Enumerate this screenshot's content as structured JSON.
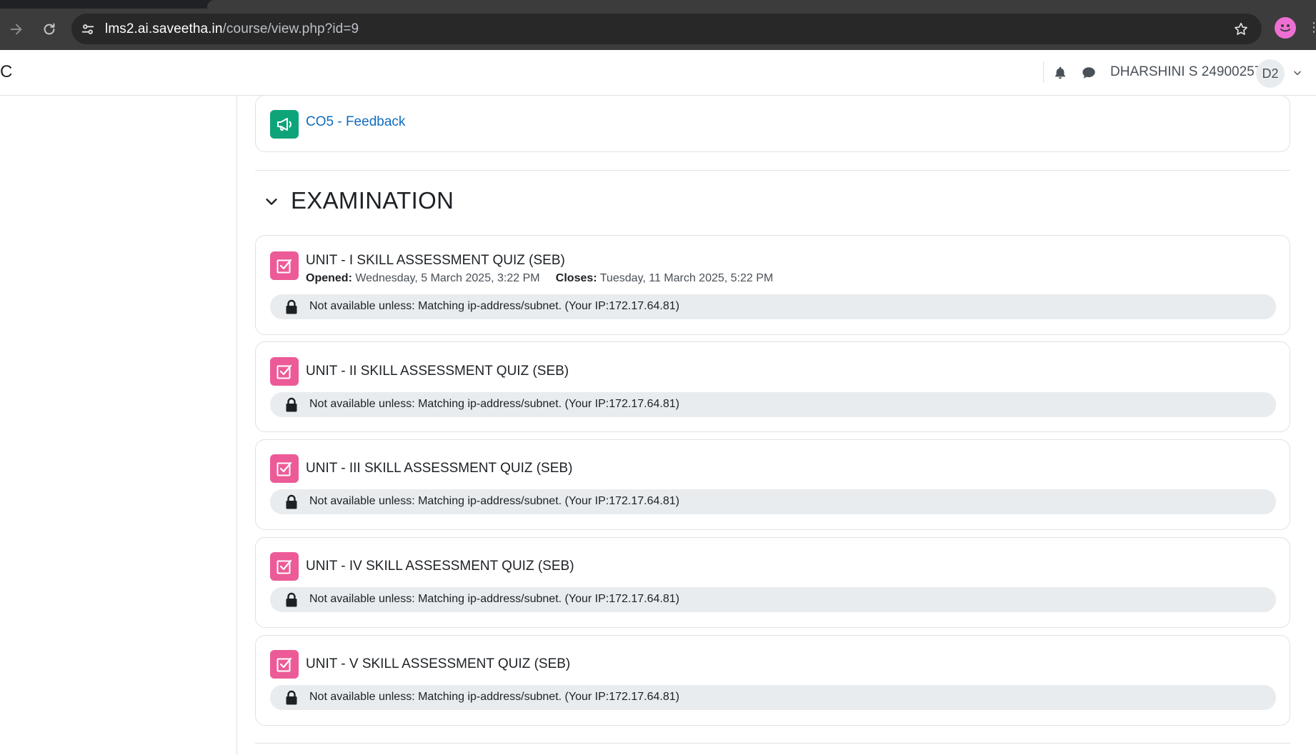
{
  "browser": {
    "url_host": "lms2.ai.saveetha.in",
    "url_path": "/course/view.php?id=9"
  },
  "header": {
    "brand_fragment": "C",
    "user_name": "DHARSHINI S 24900257",
    "avatar_initials": "D2"
  },
  "course": {
    "feedback_item": {
      "label": "CO5 - Feedback"
    },
    "section": {
      "title": "EXAMINATION",
      "quizzes": [
        {
          "title": "UNIT - I SKILL ASSESSMENT QUIZ (SEB)",
          "opened_label": "Opened:",
          "opened_value": "Wednesday, 5 March 2025, 3:22 PM",
          "closes_label": "Closes:",
          "closes_value": "Tuesday, 11 March 2025, 5:22 PM",
          "restriction": "Not available unless: Matching ip-address/subnet. (Your IP:172.17.64.81)"
        },
        {
          "title": "UNIT - II SKILL ASSESSMENT QUIZ (SEB)",
          "restriction": "Not available unless: Matching ip-address/subnet. (Your IP:172.17.64.81)"
        },
        {
          "title": "UNIT - III SKILL ASSESSMENT QUIZ (SEB)",
          "restriction": "Not available unless: Matching ip-address/subnet. (Your IP:172.17.64.81)"
        },
        {
          "title": "UNIT - IV SKILL ASSESSMENT QUIZ (SEB)",
          "restriction": "Not available unless: Matching ip-address/subnet. (Your IP:172.17.64.81)"
        },
        {
          "title": "UNIT - V SKILL ASSESSMENT QUIZ (SEB)",
          "restriction": "Not available unless: Matching ip-address/subnet. (Your IP:172.17.64.81)"
        }
      ]
    }
  },
  "icons": {
    "forward": "arrow-right-icon",
    "reload": "reload-icon",
    "site_info": "tune-icon",
    "bookmark": "star-icon",
    "profile": "smiley-icon",
    "notifications": "bell-icon",
    "messages": "chat-icon",
    "user_menu": "chevron-down-icon",
    "section_toggle": "chevron-down-icon",
    "feedback": "megaphone-icon",
    "quiz": "checkbox-icon",
    "restriction": "lock-icon"
  },
  "colors": {
    "link": "#0f6cbf",
    "feedback_icon_bg": "#0ea47a",
    "quiz_icon_bg": "#ec5b97",
    "restriction_bg": "#e9ecef",
    "chrome_bg": "#3c3c3c"
  }
}
